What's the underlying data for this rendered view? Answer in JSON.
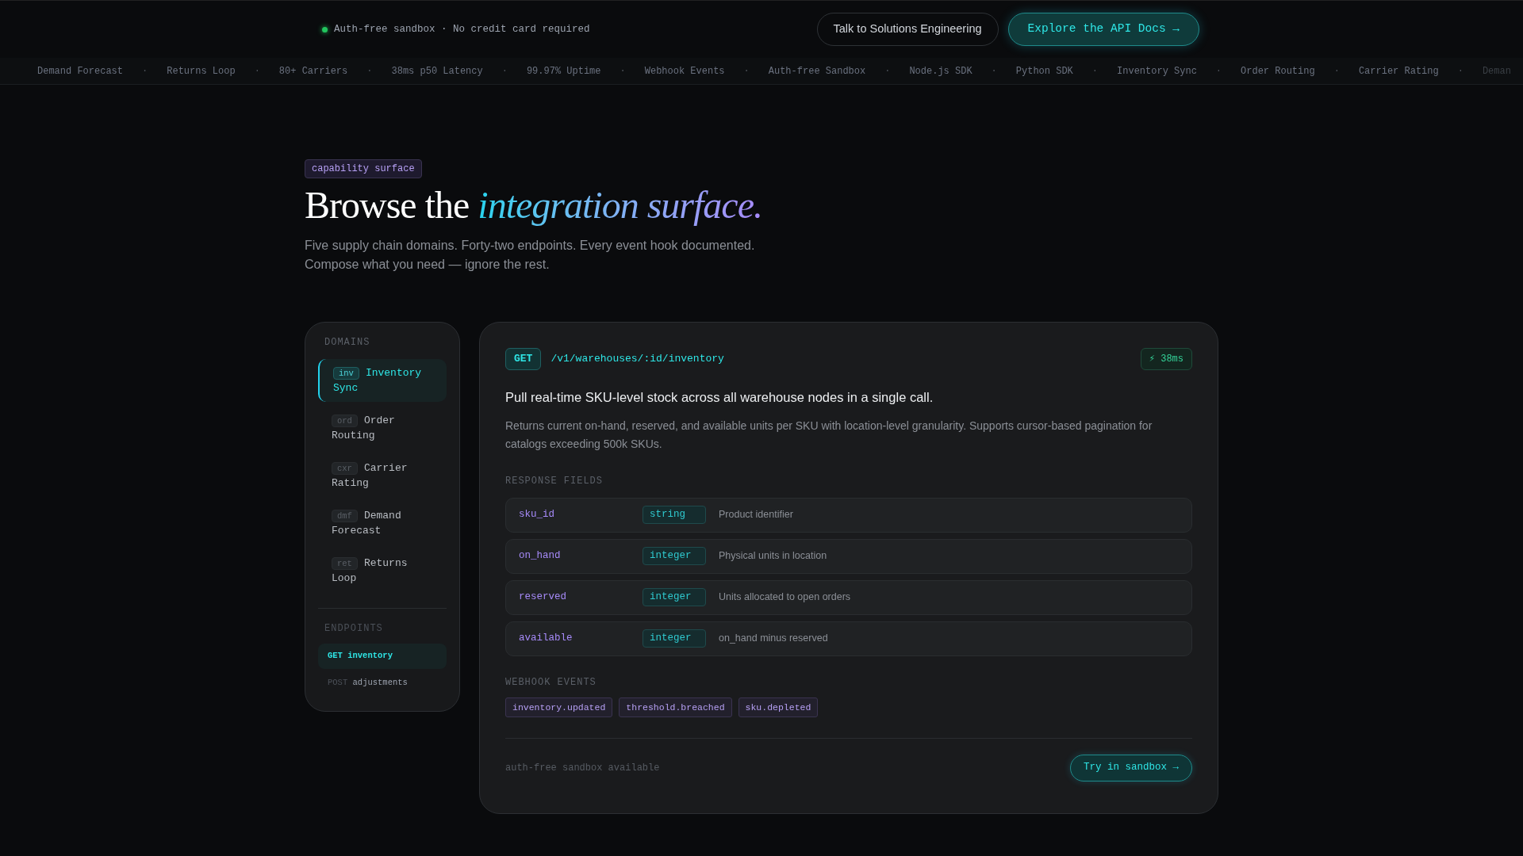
{
  "topbar": {
    "notice": "Auth-free sandbox · No credit card required",
    "buttons": [
      {
        "label": "Talk to Solutions Engineering",
        "kind": "outline"
      },
      {
        "label": "Explore the API Docs →",
        "kind": "primary"
      }
    ]
  },
  "ticker": [
    {
      "label": "Demand Forecast",
      "separator": "·"
    },
    {
      "label": "Returns Loop",
      "separator": "·"
    },
    {
      "label": "80+ Carriers",
      "separator": "·"
    },
    {
      "label": "38ms p50 Latency",
      "separator": "·"
    },
    {
      "label": "99.97% Uptime",
      "separator": "·"
    },
    {
      "label": "Webhook Events",
      "separator": "·"
    },
    {
      "label": "Auth-free Sandbox",
      "separator": "·"
    },
    {
      "label": "Node.js SDK",
      "separator": "·"
    },
    {
      "label": "Python SDK",
      "separator": "·"
    },
    {
      "label": "Inventory Sync",
      "separator": "·"
    },
    {
      "label": "Order Routing",
      "separator": "·"
    },
    {
      "label": "Carrier Rating",
      "separator": "·"
    },
    {
      "label": "Deman"
    }
  ],
  "hero": {
    "badge": "capability surface",
    "title": "Browse the",
    "title_accent": "integration surface.",
    "subtitle": [
      "Five supply chain domains. Forty-two endpoints. Every event hook documented.",
      "Compose what you need — ignore the rest."
    ]
  },
  "sidebar": {
    "domains_heading": "DOMAINS",
    "domains": [
      {
        "code": "inv",
        "label": "Inventory Sync",
        "selected": true
      },
      {
        "code": "ord",
        "label": "Order Routing",
        "selected": false
      },
      {
        "code": "cxr",
        "label": "Carrier Rating",
        "selected": false
      },
      {
        "code": "dmf",
        "label": "Demand Forecast",
        "selected": false
      },
      {
        "code": "ret",
        "label": "Returns Loop",
        "selected": false
      }
    ],
    "endpoints_heading": "ENDPOINTS",
    "endpoints": [
      {
        "method": "GET",
        "name": "inventory",
        "selected": true
      },
      {
        "method": "POST",
        "name": "adjustments",
        "selected": false
      }
    ]
  },
  "endpoint": {
    "method": "GET",
    "path": "/v1/warehouses/:id/inventory",
    "latency": "⚡ 38ms",
    "summary": "Pull real-time SKU-level stock across all warehouse nodes in a single call.",
    "description": "Returns current on-hand, reserved, and available units per SKU with location-level granularity. Supports cursor-based pagination for catalogs exceeding 500k SKUs.",
    "fields_heading": "RESPONSE FIELDS",
    "fields": [
      {
        "name": "sku_id",
        "type": "string",
        "description": "Product identifier"
      },
      {
        "name": "on_hand",
        "type": "integer",
        "description": "Physical units in location"
      },
      {
        "name": "reserved",
        "type": "integer",
        "description": "Units allocated to open orders"
      },
      {
        "name": "available",
        "type": "integer",
        "description": "on_hand minus reserved"
      }
    ],
    "webhooks_heading": "WEBHOOK EVENTS",
    "webhooks": [
      "inventory.updated",
      "threshold.breached",
      "sku.depleted"
    ],
    "footer_note": "auth-free sandbox available",
    "try_button": "Try in sandbox →"
  }
}
